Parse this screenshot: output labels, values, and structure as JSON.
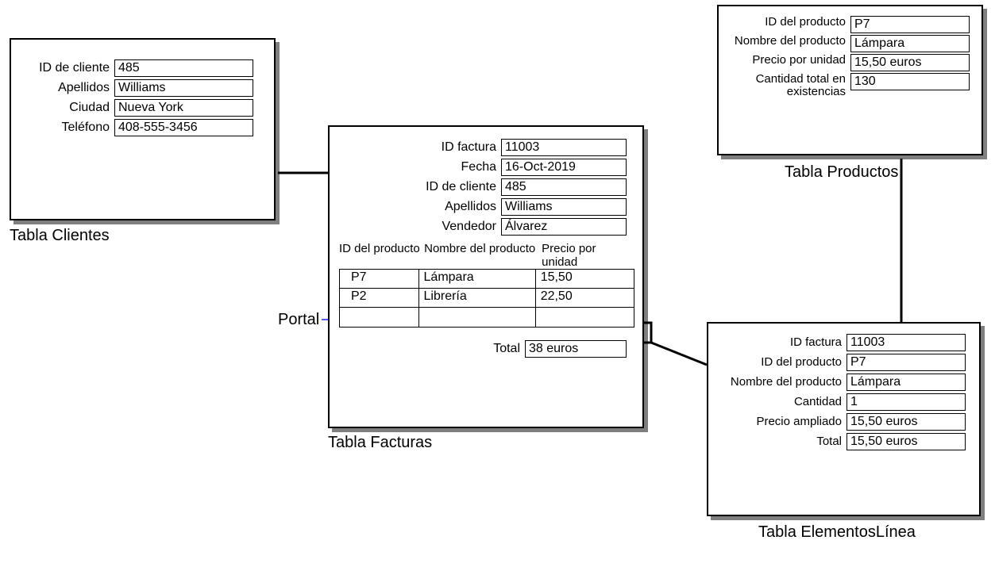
{
  "clientes": {
    "title": "Tabla Clientes",
    "fields": {
      "id_label": "ID de cliente",
      "id_value": "485",
      "apellidos_label": "Apellidos",
      "apellidos_value": "Williams",
      "ciudad_label": "Ciudad",
      "ciudad_value": "Nueva York",
      "telefono_label": "Teléfono",
      "telefono_value": "408-555-3456"
    }
  },
  "facturas": {
    "title": "Tabla Facturas",
    "fields": {
      "id_factura_label": "ID factura",
      "id_factura_value": "11003",
      "fecha_label": "Fecha",
      "fecha_value": "16-Oct-2019",
      "id_cliente_label": "ID de cliente",
      "id_cliente_value": "485",
      "apellidos_label": "Apellidos",
      "apellidos_value": "Williams",
      "vendedor_label": "Vendedor",
      "vendedor_value": "Álvarez"
    },
    "portal": {
      "label": "Portal",
      "headers": {
        "h1": "ID del producto",
        "h2": "Nombre del producto",
        "h3": "Precio por unidad"
      },
      "rows": [
        {
          "c1": "P7",
          "c2": "Lámpara",
          "c3": "15,50"
        },
        {
          "c1": "P2",
          "c2": "Librería",
          "c3": "22,50"
        },
        {
          "c1": "",
          "c2": "",
          "c3": ""
        }
      ]
    },
    "total_label": "Total",
    "total_value": "38 euros"
  },
  "productos": {
    "title": "Tabla Productos",
    "fields": {
      "id_label": "ID del producto",
      "id_value": "P7",
      "nombre_label": "Nombre del producto",
      "nombre_value": "Lámpara",
      "precio_label": "Precio por unidad",
      "precio_value": "15,50 euros",
      "cantidad_label_1": "Cantidad total en",
      "cantidad_label_2": "existencias",
      "cantidad_value": "130"
    }
  },
  "elementos": {
    "title": "Tabla ElementosLínea",
    "fields": {
      "id_factura_label": "ID factura",
      "id_factura_value": "11003",
      "id_producto_label": "ID del producto",
      "id_producto_value": "P7",
      "nombre_label": "Nombre del producto",
      "nombre_value": "Lámpara",
      "cantidad_label": "Cantidad",
      "cantidad_value": "1",
      "precio_amp_label": "Precio ampliado",
      "precio_amp_value": "15,50 euros",
      "total_label": "Total",
      "total_value": "15,50 euros"
    }
  }
}
